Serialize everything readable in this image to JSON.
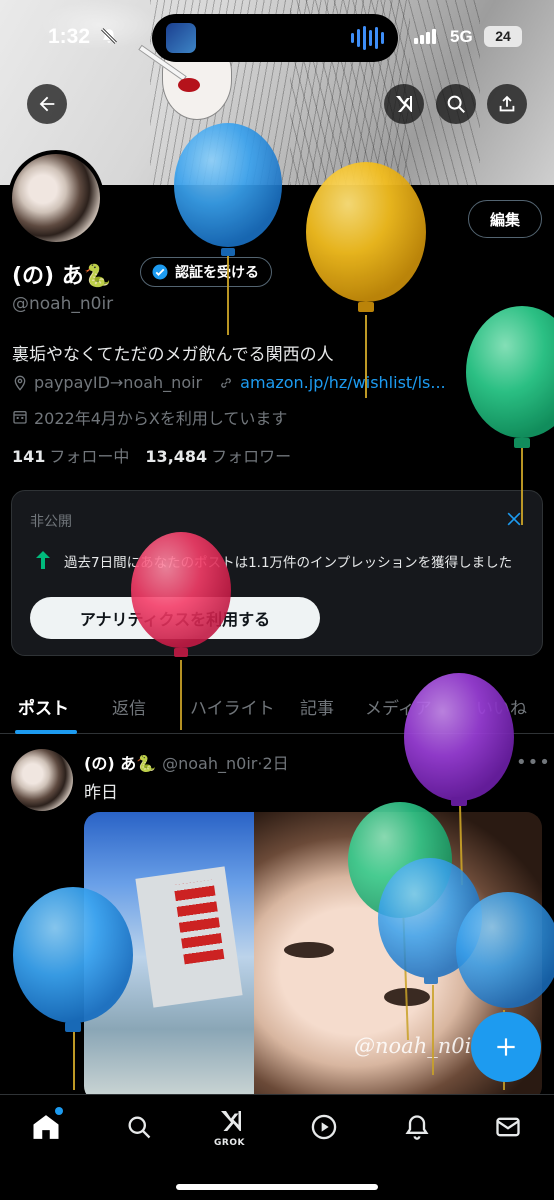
{
  "status_bar": {
    "time": "1:32",
    "network": "5G",
    "battery": "24"
  },
  "header": {
    "back_icon": "arrow-left-icon",
    "grok_icon": "grok-icon",
    "search_icon": "search-icon",
    "share_icon": "share-icon"
  },
  "profile": {
    "edit_label": "編集",
    "display_name": "(の) あ🐍",
    "verify_label": "認証を受ける",
    "handle": "@noah_n0ir",
    "bio": "裏垢やなくてただのメガ飲んでる関西の人",
    "location": "paypayID→noah_noir",
    "link": "amazon.jp/hz/wishlist/ls...",
    "joined": "2022年4月からXを利用しています",
    "following_count": "141",
    "following_label": "フォロー中",
    "followers_count": "13,484",
    "followers_label": "フォロワー"
  },
  "private_card": {
    "label": "非公開",
    "message": "過去7日間にあなたのポストは1.1万件のインプレッションを獲得しました",
    "button": "アナリティクスを利用する"
  },
  "tabs": [
    "ポスト",
    "返信",
    "ハイライト",
    "記事",
    "メディア",
    "いいね"
  ],
  "post": {
    "name": "(の) あ🐍",
    "handle": "@noah_n0ir",
    "time": "2日",
    "text": "昨日",
    "watermark": "@noah_n0ir"
  },
  "bottom_nav": {
    "grok_label": "GROK"
  },
  "colors": {
    "accent": "#1d9bf0",
    "background": "#000000",
    "muted": "#71767b",
    "positive": "#00ba7c"
  }
}
